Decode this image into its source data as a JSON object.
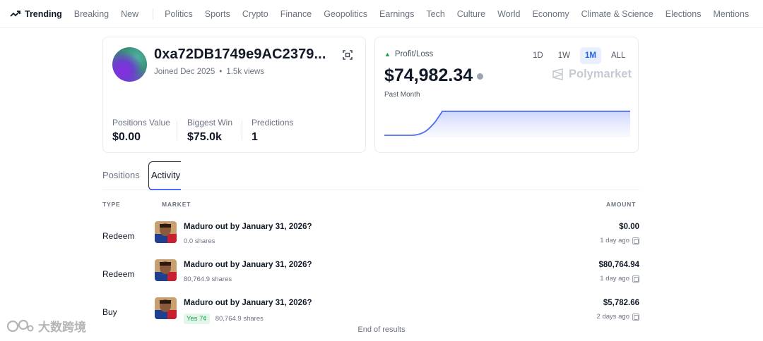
{
  "nav": {
    "trending": "Trending",
    "items": [
      "Breaking",
      "New"
    ],
    "categories": [
      "Politics",
      "Sports",
      "Crypto",
      "Finance",
      "Geopolitics",
      "Earnings",
      "Tech",
      "Culture",
      "World",
      "Economy",
      "Climate & Science",
      "Elections",
      "Mentions"
    ]
  },
  "profile": {
    "address": "0xa72DB1749e9AC2379...",
    "joined": "Joined Dec 2025",
    "views": "1.5k views",
    "stats": [
      {
        "label": "Positions Value",
        "value": "$0.00"
      },
      {
        "label": "Biggest Win",
        "value": "$75.0k"
      },
      {
        "label": "Predictions",
        "value": "1"
      }
    ]
  },
  "pnl": {
    "label": "Profit/Loss",
    "value": "$74,982.34",
    "period": "Past Month",
    "timeframes": [
      "1D",
      "1W",
      "1M",
      "ALL"
    ],
    "active_timeframe": "1M",
    "brand": "Polymarket",
    "accent": "#4f6df5"
  },
  "tabs": {
    "positions": "Positions",
    "activity": "Activity"
  },
  "table": {
    "headers": {
      "type": "TYPE",
      "market": "MARKET",
      "amount": "AMOUNT"
    },
    "rows": [
      {
        "type": "Redeem",
        "title": "Maduro out by January 31, 2026?",
        "badge": "",
        "shares": "0.0 shares",
        "amount": "$0.00",
        "time": "1 day ago"
      },
      {
        "type": "Redeem",
        "title": "Maduro out by January 31, 2026?",
        "badge": "",
        "shares": "80,764.9 shares",
        "amount": "$80,764.94",
        "time": "1 day ago"
      },
      {
        "type": "Buy",
        "title": "Maduro out by January 31, 2026?",
        "badge": "Yes 7¢",
        "shares": "80,764.9 shares",
        "amount": "$5,782.66",
        "time": "2 days ago"
      }
    ],
    "end": "End of results"
  },
  "watermark": "大数跨境"
}
